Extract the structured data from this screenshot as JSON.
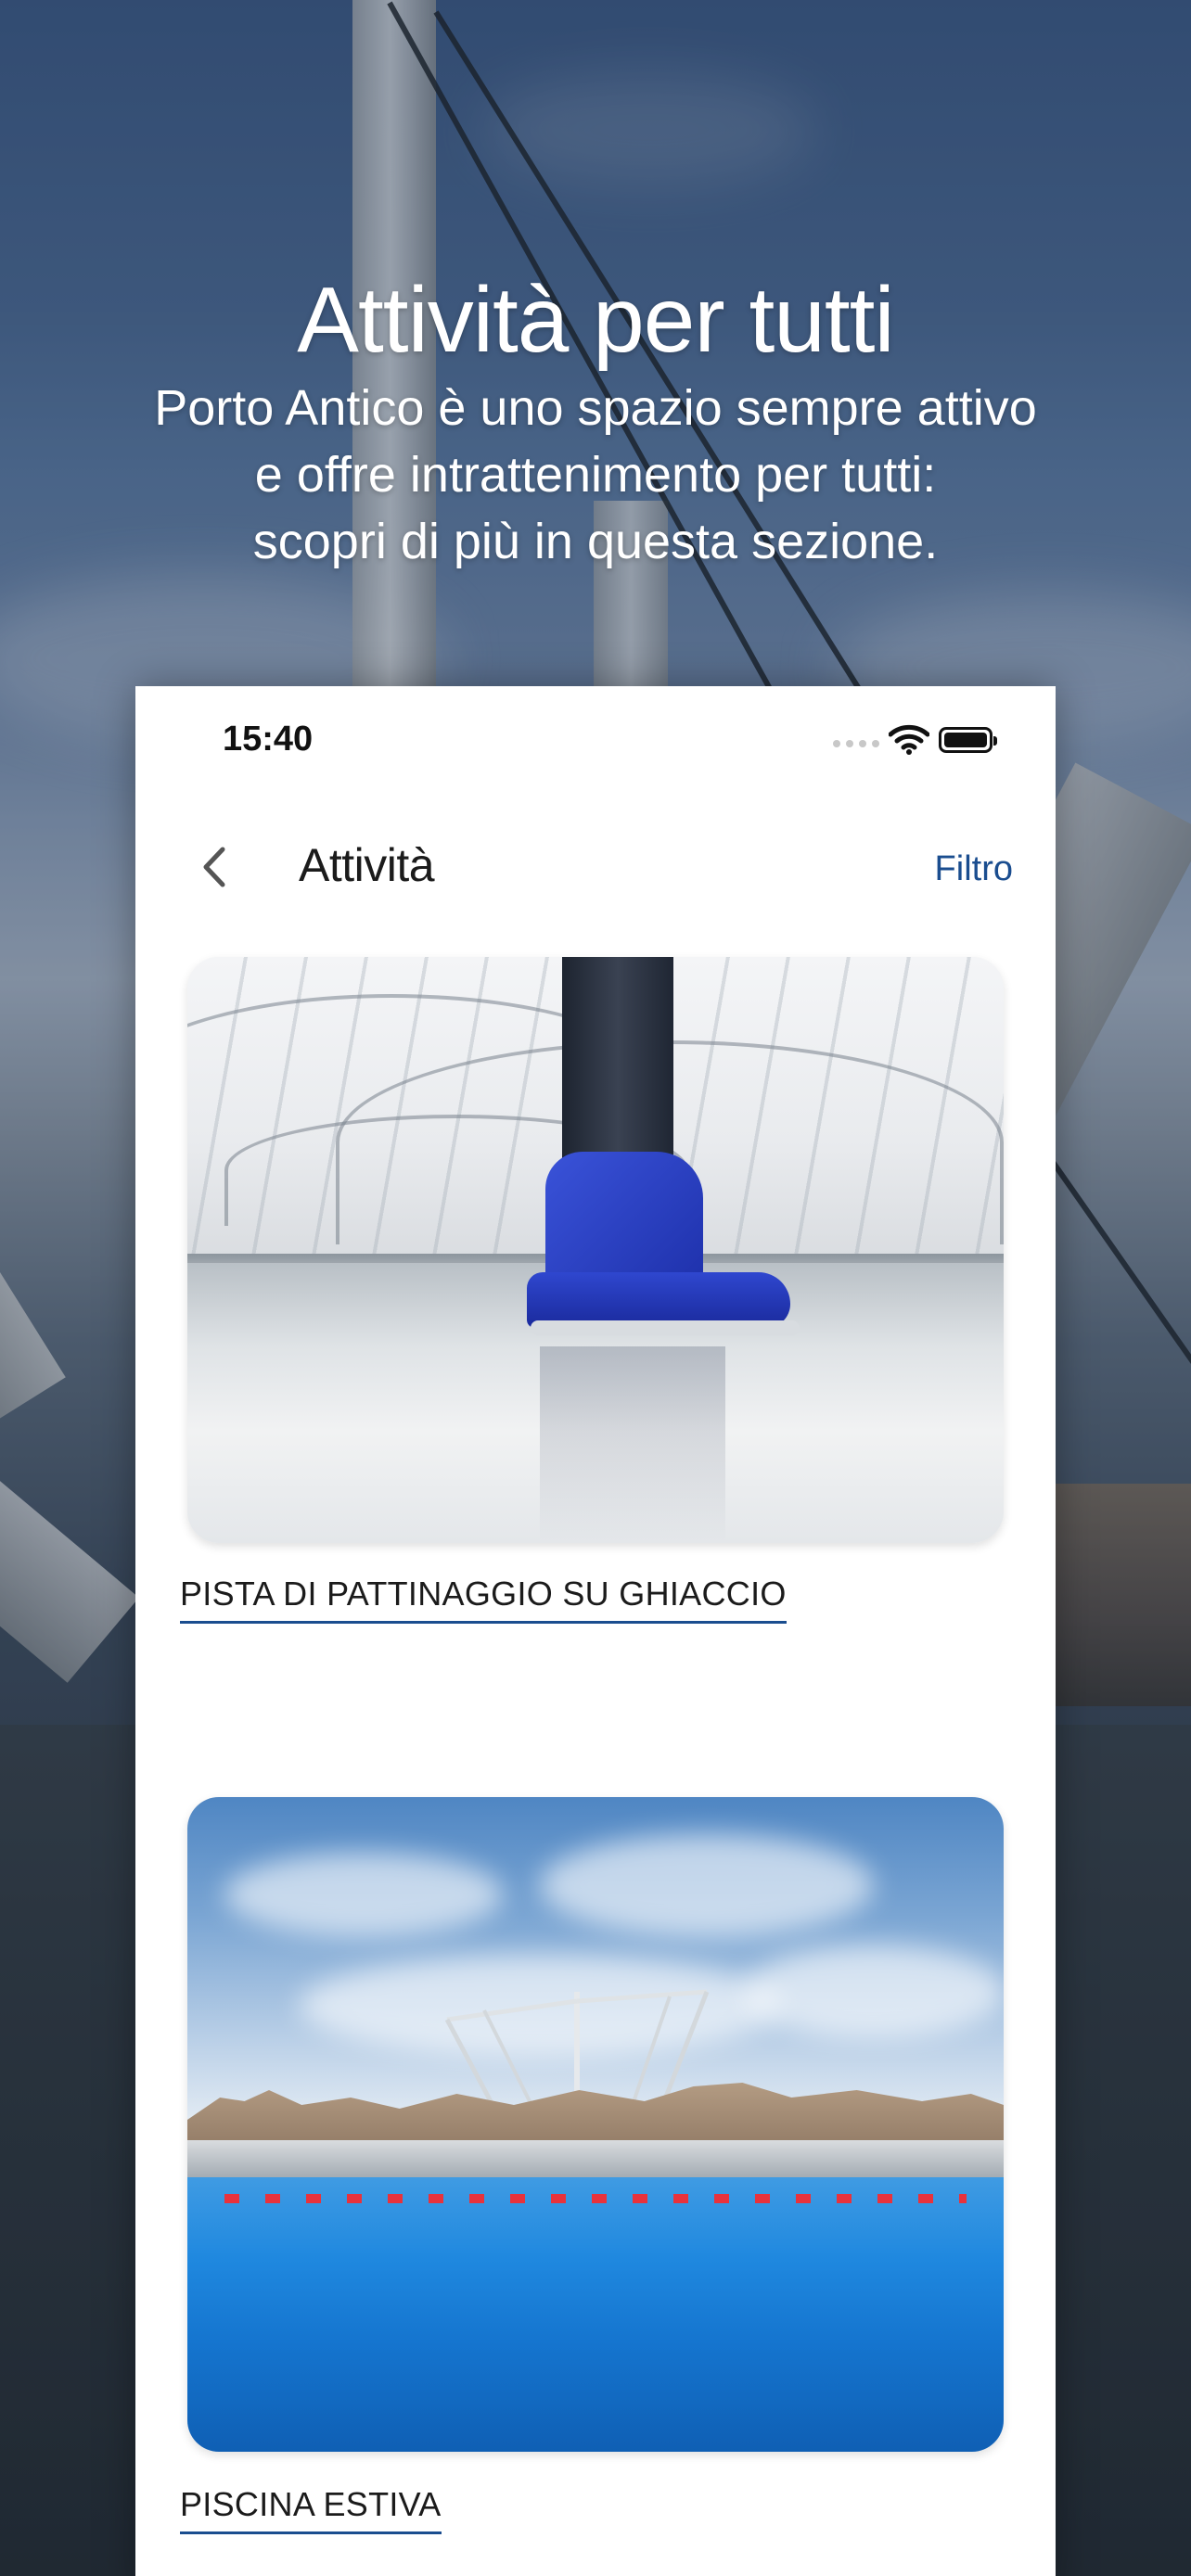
{
  "hero": {
    "title": "Attività per tutti",
    "subtitle_lines": [
      "Porto Antico è uno spazio sempre attivo",
      "e offre intrattenimento per tutti:",
      "scopri di più in questa sezione."
    ]
  },
  "status_bar": {
    "time": "15:40",
    "icons": [
      "signal-icon",
      "wifi-icon",
      "battery-icon"
    ]
  },
  "nav": {
    "back_icon": "chevron-left-icon",
    "title": "Attività",
    "filter_label": "Filtro"
  },
  "activities": [
    {
      "label": "PISTA DI PATTINAGGIO SU GHIACCIO",
      "image": "ice-skating-rink-photo"
    },
    {
      "label": "PISCINA ESTIVA",
      "image": "summer-pool-photo"
    }
  ],
  "colors": {
    "accent": "#1a4d8f",
    "text": "#1b1b1b",
    "card_background": "#ffffff"
  }
}
